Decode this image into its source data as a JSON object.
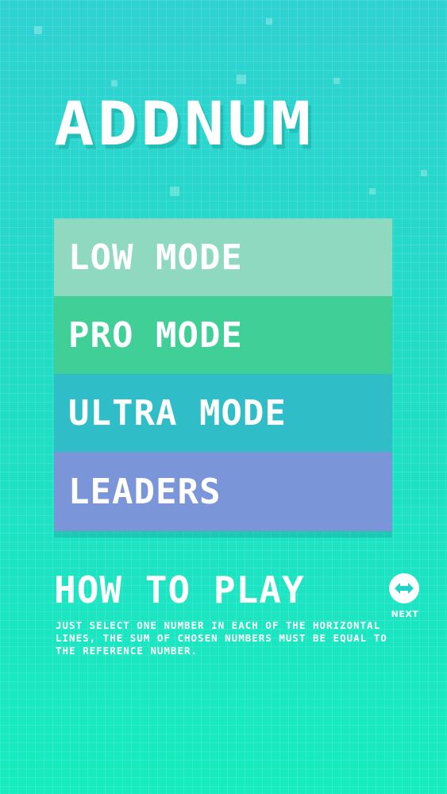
{
  "app": {
    "title": "ADDNUM"
  },
  "menu": {
    "items": [
      {
        "label": "LOW MODE",
        "color": "#8fd9c1"
      },
      {
        "label": "PRO MODE",
        "color": "#3fcf97"
      },
      {
        "label": "ULTRA MODE",
        "color": "#2fbec8"
      },
      {
        "label": "LEADERS",
        "color": "#7a96d8"
      }
    ]
  },
  "how_to_play": {
    "heading": "HOW TO PLAY",
    "text": "JUST SELECT ONE NUMBER IN EACH OF THE HORIZONTAL LINES, THE SUM OF CHOSEN NUMBERS MUST BE EQUAL TO THE REFERENCE NUMBER.",
    "next_label": "NEXT",
    "next_icon": "arrows-left-right-icon"
  },
  "colors": {
    "background_top": "#2fd2d2",
    "background_bottom": "#16ecbe",
    "text": "#ffffff"
  }
}
